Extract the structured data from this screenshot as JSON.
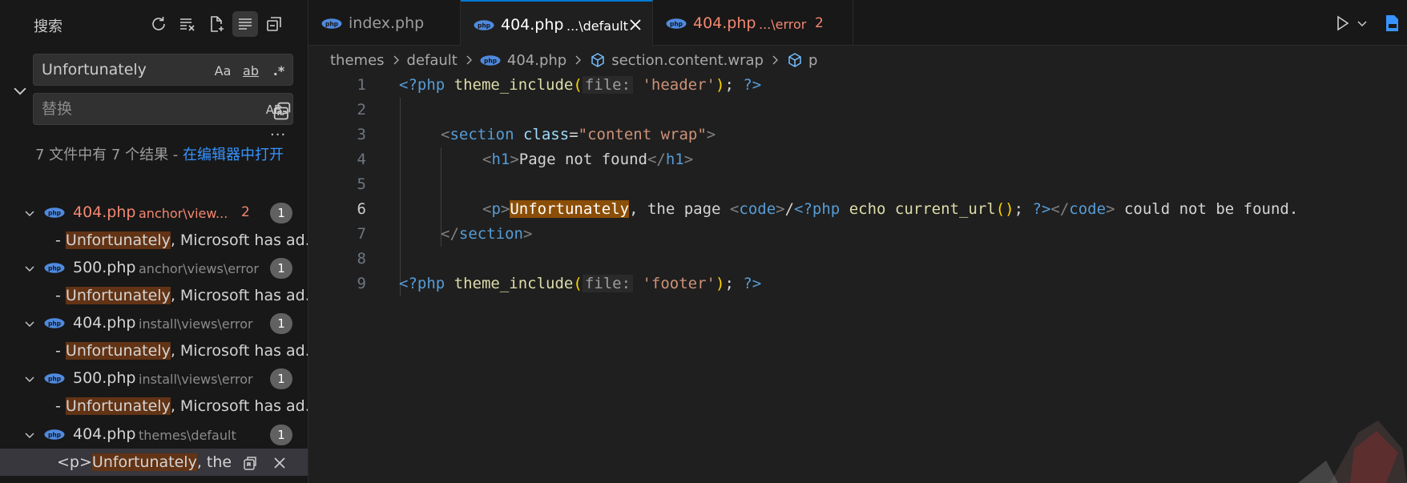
{
  "sidebar": {
    "title": "搜索",
    "search": {
      "value": "Unfortunately",
      "opt_case": "Aa",
      "opt_word": "ab",
      "opt_regex": ".*"
    },
    "replace": {
      "placeholder": "替换",
      "opt_preserve_case": "AB"
    },
    "more": "···",
    "summary_prefix": "7 文件中有 7 个结果 - ",
    "summary_link": "在编辑器中打开",
    "results": [
      {
        "file": "404.php",
        "path": "anchor\\view...",
        "errors": "2",
        "count": "1",
        "error": true,
        "match_hl": "Unfortunately",
        "match_rest": ", Microsoft has ad...",
        "match_prefix": "- "
      },
      {
        "file": "500.php",
        "path": "anchor\\views\\error",
        "errors": "",
        "count": "1",
        "error": false,
        "match_hl": "Unfortunately",
        "match_rest": ", Microsoft has ad...",
        "match_prefix": "- "
      },
      {
        "file": "404.php",
        "path": "install\\views\\error",
        "errors": "",
        "count": "1",
        "error": false,
        "match_hl": "Unfortunately",
        "match_rest": ", Microsoft has ad...",
        "match_prefix": "- "
      },
      {
        "file": "500.php",
        "path": "install\\views\\error",
        "errors": "",
        "count": "1",
        "error": false,
        "match_hl": "Unfortunately",
        "match_rest": ", Microsoft has ad...",
        "match_prefix": "- "
      },
      {
        "file": "404.php",
        "path": "themes\\default",
        "errors": "",
        "count": "1",
        "error": false,
        "match_hl": "Unfortunately",
        "match_rest": ", the...",
        "match_prefix": "<p>"
      }
    ]
  },
  "tabs": [
    {
      "name": "index.php",
      "desc": "",
      "errors": ""
    },
    {
      "name": "404.php",
      "desc": "...\\default",
      "errors": ""
    },
    {
      "name": "404.php",
      "desc": "...\\error",
      "errors": "2"
    }
  ],
  "breadcrumb": [
    "themes",
    "default",
    "404.php",
    "section.content.wrap",
    "p"
  ],
  "code": {
    "line_numbers": [
      "1",
      "2",
      "3",
      "4",
      "5",
      "6",
      "7",
      "8",
      "9"
    ],
    "l1": {
      "open": "<?php",
      "fn": "theme_include",
      "lp": "(",
      "hint": "file:",
      "str": "'header'",
      "rp": ")",
      "semi": "; ",
      "close": "?>"
    },
    "l3": {
      "lt": "<",
      "tag": "section",
      "sp": " ",
      "attr": "class",
      "eq": "=",
      "val": "\"content wrap\"",
      "gt": ">"
    },
    "l4": {
      "lt": "<",
      "tag": "h1",
      "gt": ">",
      "text": "Page not found",
      "lt2": "</",
      "tag2": "h1",
      "gt2": ">"
    },
    "l6": {
      "lt": "<",
      "tag": "p",
      "gt": ">",
      "hl": "Unfortunately",
      "text1": ", the page ",
      "lt2": "<",
      "tag2": "code",
      "gt2": ">",
      "slash": "/",
      "open": "<?php",
      "echo": " echo ",
      "fn": "current_url",
      "par": "()",
      "semi": "; ",
      "close": "?>",
      "lt3": "</",
      "tag3": "code",
      "gt3": ">",
      "text2": " could not be found."
    },
    "l7": {
      "lt": "</",
      "tag": "section",
      "gt": ">"
    },
    "l9": {
      "open": "<?php",
      "fn": "theme_include",
      "lp": "(",
      "hint": "file:",
      "str": "'footer'",
      "rp": ")",
      "semi": "; ",
      "close": "?>"
    }
  }
}
